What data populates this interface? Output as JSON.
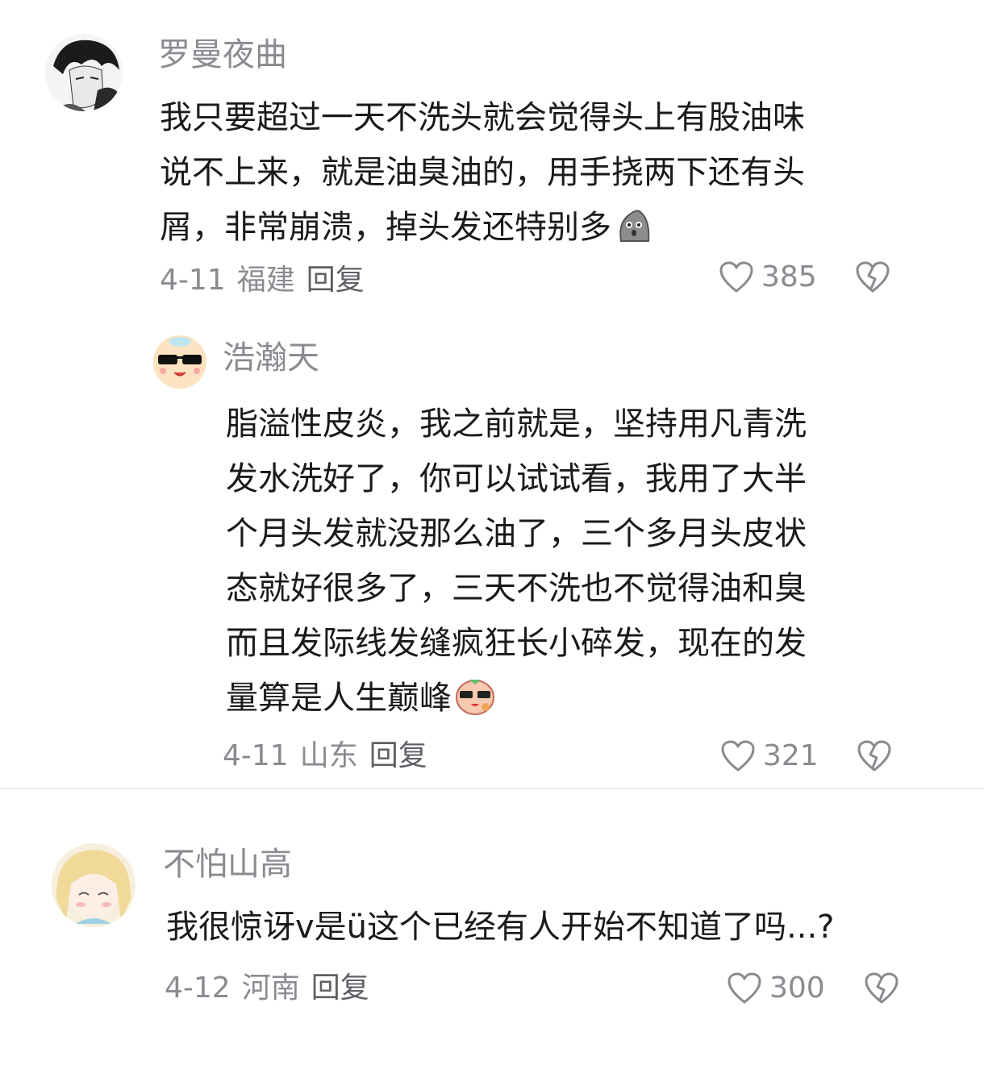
{
  "comments": [
    {
      "username": "罗曼夜曲",
      "lines": [
        "我只要超过一天不洗头就会觉得头上有股油味",
        "说不上来，就是油臭油的，用手挠两下还有头",
        "屑，非常崩溃，掉头发还特别多"
      ],
      "emoji": "grey-blob-emoji",
      "date": "4-11",
      "region": "福建",
      "reply_label": "回复",
      "likes": "385"
    },
    {
      "username": "浩瀚天",
      "lines": [
        "脂溢性皮炎，我之前就是，坚持用凡青洗",
        "发水洗好了，你可以试试看，我用了大半",
        "个月头发就没那么油了，三个多月头皮状",
        "态就好很多了，三天不洗也不觉得油和臭",
        "而且发际线发缝疯狂长小碎发，现在的发",
        "量算是人生巅峰"
      ],
      "emoji": "cool-face-emoji",
      "date": "4-11",
      "region": "山东",
      "reply_label": "回复",
      "likes": "321"
    },
    {
      "username": "不怕山高",
      "lines": [
        "我很惊讶v是ü这个已经有人开始不知道了吗...?"
      ],
      "date": "4-12",
      "region": "河南",
      "reply_label": "回复",
      "likes": "300"
    }
  ],
  "icons": {
    "like": "heart-outline-icon",
    "dislike": "broken-heart-icon"
  },
  "colors": {
    "text": "#1a1a1a",
    "secondary": "#8a8b91",
    "divider": "#eeeeee"
  }
}
